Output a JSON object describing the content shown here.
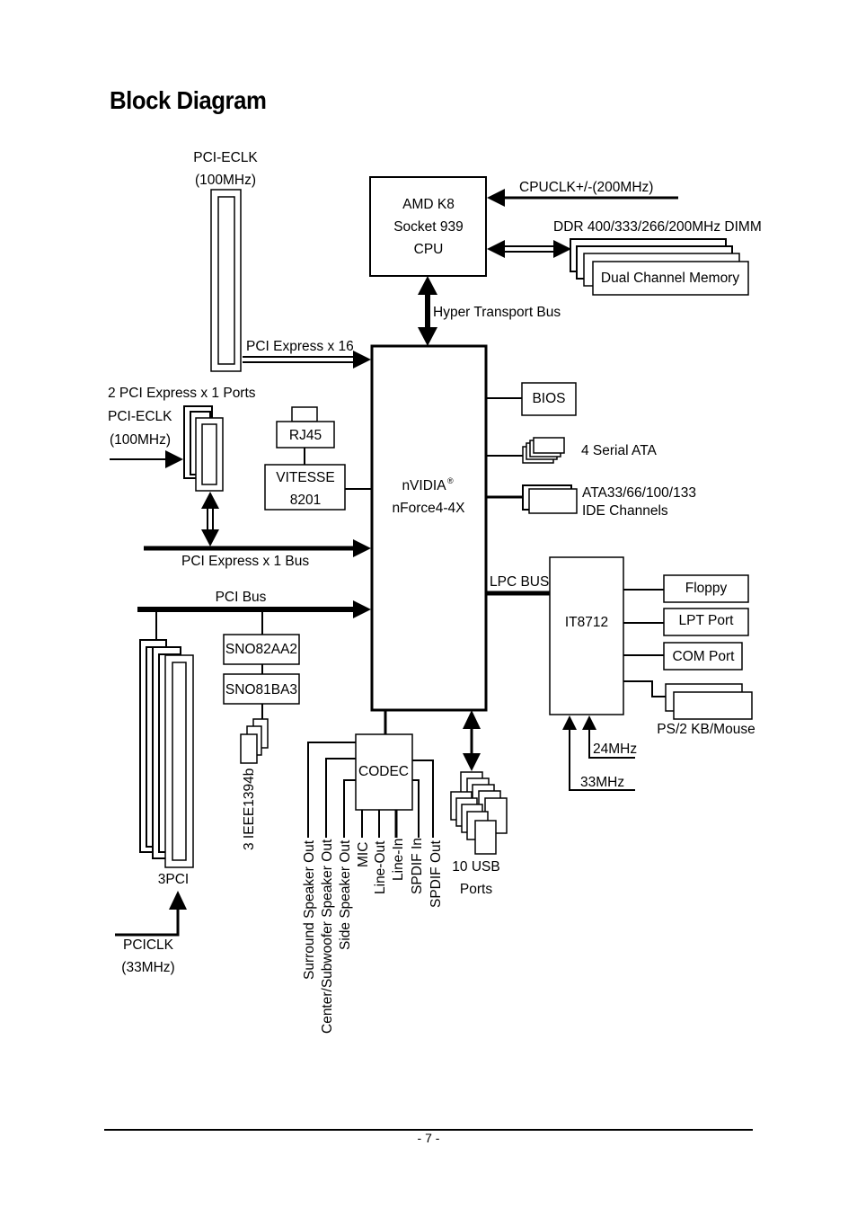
{
  "page": {
    "title": "Block Diagram",
    "page_number": "- 7 -"
  },
  "cpu": {
    "line1": "AMD K8",
    "line2": "Socket 939",
    "line3": "CPU"
  },
  "cpuclk": {
    "label": "CPUCLK+/-(200MHz)"
  },
  "memory": {
    "dimm_label": "DDR 400/333/266/200MHz DIMM",
    "box_label": "Dual Channel Memory"
  },
  "hyper_transport": {
    "label": "Hyper Transport Bus"
  },
  "pcie16": {
    "clk_line1": "PCI-ECLK",
    "clk_line2": "(100MHz)",
    "bus_label": "PCI Express x 16"
  },
  "pcie1": {
    "ports_label": "2 PCI Express x 1 Ports",
    "clk_line1": "PCI-ECLK",
    "clk_line2": "(100MHz)",
    "bus_label": "PCI Express x 1 Bus"
  },
  "lan": {
    "rj45": "RJ45",
    "phy_line1": "VITESSE",
    "phy_line2": "8201"
  },
  "chipset": {
    "line1": "nVIDIA",
    "reg_mark": "®",
    "line2": "nForce4-4X"
  },
  "bios": {
    "label": "BIOS"
  },
  "sata": {
    "label": "4 Serial ATA"
  },
  "ide": {
    "line1": "ATA33/66/100/133",
    "line2": "IDE Channels"
  },
  "lpc": {
    "bus_label": "LPC BUS"
  },
  "superio": {
    "label": "IT8712",
    "floppy": "Floppy",
    "lpt": "LPT Port",
    "com": "COM Port",
    "ps2": "PS/2 KB/Mouse",
    "clk24": "24MHz",
    "clk33": "33MHz"
  },
  "pci": {
    "bus_label": "PCI Bus",
    "slots_label": "3PCI",
    "clk_line1": "PCICLK",
    "clk_line2": "(33MHz)"
  },
  "ieee1394": {
    "chip1": "SNO82AA2",
    "chip2": "SNO81BA3",
    "ports_label": "3 IEEE1394b"
  },
  "codec": {
    "label": "CODEC",
    "outputs": [
      "Surround Speaker Out",
      "Center/Subwoofer Speaker Out",
      "Side Speaker Out",
      "MIC",
      "Line-Out",
      "Line-In",
      "SPDIF In",
      "SPDIF Out"
    ]
  },
  "usb": {
    "line1": "10 USB",
    "line2": "Ports"
  }
}
